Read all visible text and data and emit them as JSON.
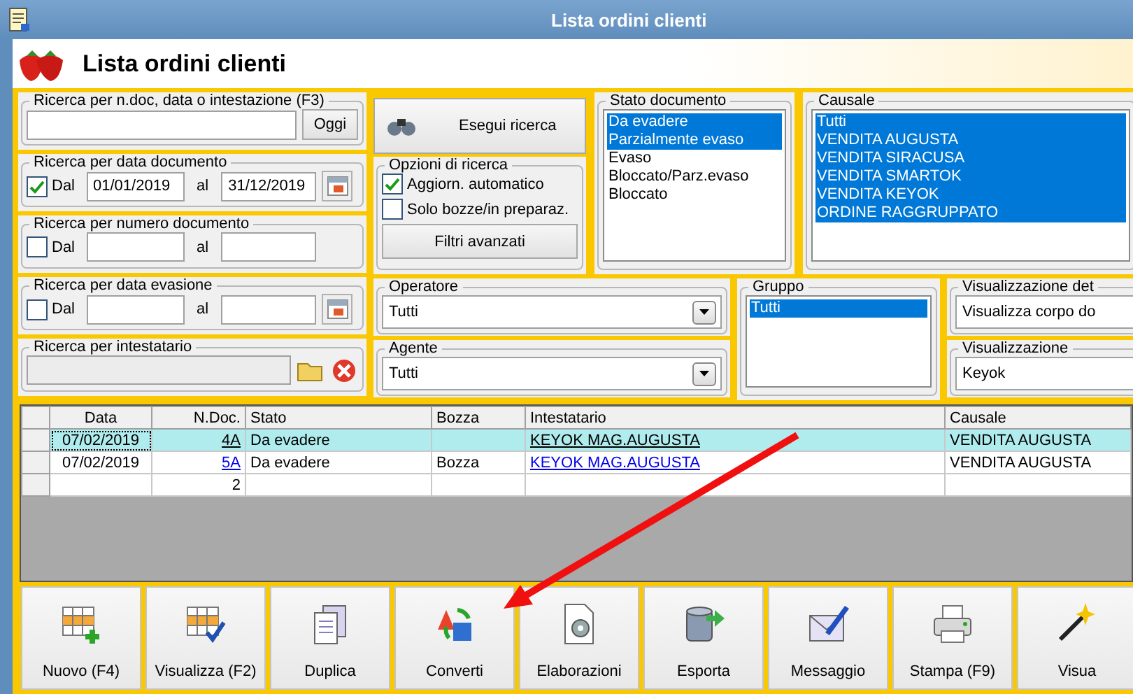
{
  "window": {
    "title": "Lista ordini clienti"
  },
  "header": {
    "title": "Lista ordini clienti"
  },
  "search": {
    "title": "Ricerca per n.doc, data o intestazione (F3)",
    "button": "Oggi"
  },
  "date_filters": [
    {
      "title": "Ricerca per data documento",
      "check_label": "Dal",
      "checked": true,
      "from": "01/01/2019",
      "to_label": "al",
      "to": "31/12/2019",
      "calendar": true
    },
    {
      "title": "Ricerca per numero documento",
      "check_label": "Dal",
      "checked": false,
      "to_label": "al",
      "calendar": false
    },
    {
      "title": "Ricerca per data evasione",
      "check_label": "Dal",
      "checked": false,
      "to_label": "al",
      "calendar": true
    }
  ],
  "holder": {
    "title": "Ricerca per intestatario"
  },
  "search_button": "Esegui ricerca",
  "options": {
    "title": "Opzioni di ricerca",
    "items": [
      {
        "label": "Aggiorn. automatico",
        "checked": true
      },
      {
        "label": "Solo bozze/in preparaz.",
        "checked": false
      }
    ],
    "button": "Filtri avanzati"
  },
  "stato": {
    "title": "Stato documento",
    "items": [
      {
        "label": "Da evadere",
        "selected": true
      },
      {
        "label": "Parzialmente evaso",
        "selected": true
      },
      {
        "label": "Evaso",
        "selected": false
      },
      {
        "label": "Bloccato/Parz.evaso",
        "selected": false
      },
      {
        "label": "Bloccato",
        "selected": false
      }
    ]
  },
  "causale": {
    "title": "Causale",
    "items": [
      {
        "label": "Tutti",
        "selected": true
      },
      {
        "label": "VENDITA AUGUSTA",
        "selected": true
      },
      {
        "label": "VENDITA SIRACUSA",
        "selected": true
      },
      {
        "label": "VENDITA SMARTOK",
        "selected": true
      },
      {
        "label": "VENDITA KEYOK",
        "selected": true
      },
      {
        "label": "ORDINE RAGGRUPPATO",
        "selected": true
      }
    ]
  },
  "operatore": {
    "title": "Operatore",
    "value": "Tutti"
  },
  "agente": {
    "title": "Agente",
    "value": "Tutti"
  },
  "gruppo": {
    "title": "Gruppo",
    "items": [
      {
        "label": "Tutti",
        "selected": true
      }
    ]
  },
  "detail_view": {
    "title": "Visualizzazione det",
    "value": "Visualizza corpo do"
  },
  "view": {
    "title": "Visualizzazione",
    "value": "Keyok"
  },
  "table": {
    "columns": [
      "Data",
      "N.Doc.",
      "Stato",
      "Bozza",
      "Intestatario",
      "Causale"
    ],
    "rows": [
      {
        "selected": true,
        "cells": [
          "07/02/2019",
          "4A",
          "Da evadere",
          "",
          "KEYOK MAG.AUGUSTA",
          "VENDITA AUGUSTA"
        ]
      },
      {
        "selected": false,
        "cells": [
          "07/02/2019",
          "5A",
          "Da evadere",
          "Bozza",
          "KEYOK MAG.AUGUSTA",
          "VENDITA AUGUSTA"
        ]
      },
      {
        "selected": false,
        "cells": [
          "",
          "2",
          "",
          "",
          "",
          ""
        ]
      }
    ]
  },
  "toolbar": [
    {
      "label": "Nuovo (F4)",
      "kind": "new"
    },
    {
      "label": "Visualizza (F2)",
      "kind": "view"
    },
    {
      "label": "Duplica",
      "kind": "duplicate"
    },
    {
      "label": "Converti",
      "kind": "convert"
    },
    {
      "label": "Elaborazioni",
      "kind": "process"
    },
    {
      "label": "Esporta",
      "kind": "export"
    },
    {
      "label": "Messaggio",
      "kind": "message"
    },
    {
      "label": "Stampa (F9)",
      "kind": "print"
    },
    {
      "label": "Visua",
      "kind": "wand"
    }
  ]
}
